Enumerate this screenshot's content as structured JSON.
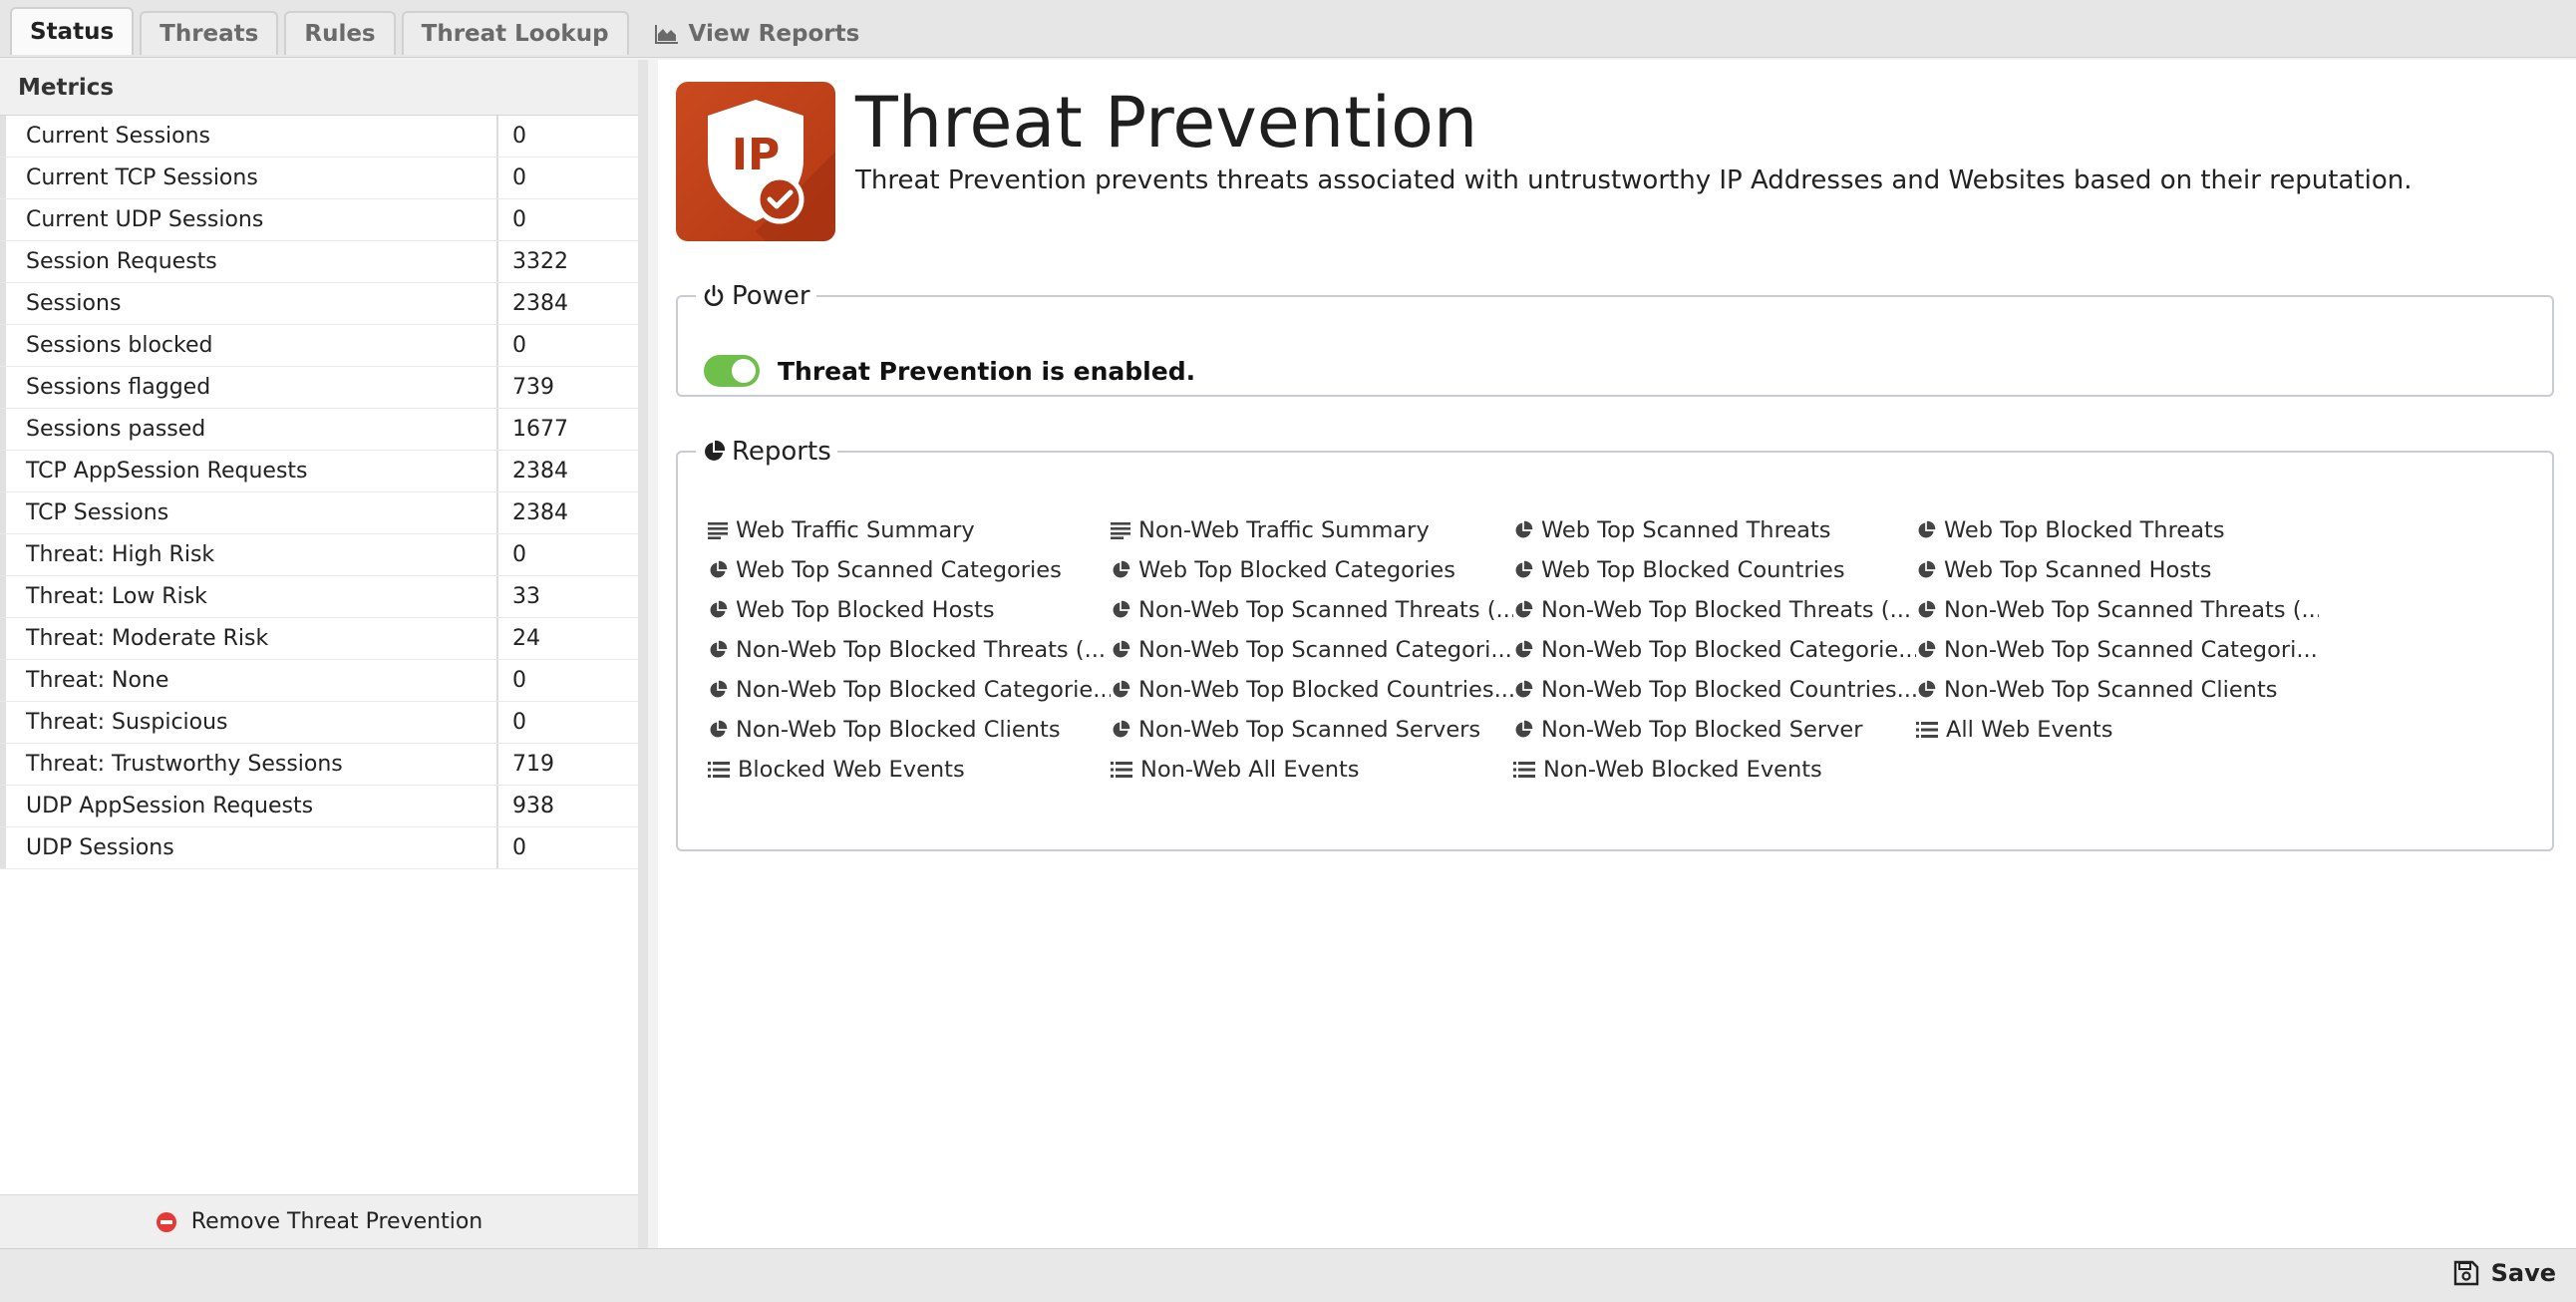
{
  "tabs": [
    {
      "label": "Status",
      "active": true
    },
    {
      "label": "Threats"
    },
    {
      "label": "Rules"
    },
    {
      "label": "Threat Lookup"
    },
    {
      "label": "View Reports",
      "icon": "area-chart-icon"
    }
  ],
  "metrics": {
    "header": "Metrics",
    "rows": [
      {
        "name": "Current Sessions",
        "value": "0"
      },
      {
        "name": "Current TCP Sessions",
        "value": "0"
      },
      {
        "name": "Current UDP Sessions",
        "value": "0"
      },
      {
        "name": "Session Requests",
        "value": "3322"
      },
      {
        "name": "Sessions",
        "value": "2384"
      },
      {
        "name": "Sessions blocked",
        "value": "0"
      },
      {
        "name": "Sessions flagged",
        "value": "739"
      },
      {
        "name": "Sessions passed",
        "value": "1677"
      },
      {
        "name": "TCP AppSession Requests",
        "value": "2384"
      },
      {
        "name": "TCP Sessions",
        "value": "2384"
      },
      {
        "name": "Threat: High Risk",
        "value": "0"
      },
      {
        "name": "Threat: Low Risk",
        "value": "33"
      },
      {
        "name": "Threat: Moderate Risk",
        "value": "24"
      },
      {
        "name": "Threat: None",
        "value": "0"
      },
      {
        "name": "Threat: Suspicious",
        "value": "0"
      },
      {
        "name": "Threat: Trustworthy Sessions",
        "value": "719"
      },
      {
        "name": "UDP AppSession Requests",
        "value": "938"
      },
      {
        "name": "UDP Sessions",
        "value": "0"
      }
    ],
    "remove_label": "Remove Threat Prevention"
  },
  "app": {
    "icon_text": "IP",
    "title": "Threat Prevention",
    "description": "Threat Prevention prevents threats associated with untrustworthy IP Addresses and Websites based on their reputation."
  },
  "power": {
    "legend": "Power",
    "status": "Threat Prevention is enabled.",
    "enabled": true,
    "toggle_color": "#6ec04b"
  },
  "reports": {
    "legend": "Reports",
    "items": [
      {
        "label": "Web Traffic Summary",
        "icon": "text-lines-icon"
      },
      {
        "label": "Non-Web Traffic Summary",
        "icon": "text-lines-icon"
      },
      {
        "label": "Web Top Scanned Threats",
        "icon": "pie-chart-icon"
      },
      {
        "label": "Web Top Blocked Threats",
        "icon": "pie-chart-icon"
      },
      {
        "label": "Web Top Scanned Categories",
        "icon": "pie-chart-icon"
      },
      {
        "label": "Web Top Blocked Categories",
        "icon": "pie-chart-icon"
      },
      {
        "label": "Web Top Blocked Countries",
        "icon": "pie-chart-icon"
      },
      {
        "label": "Web Top Scanned Hosts",
        "icon": "pie-chart-icon"
      },
      {
        "label": "Web Top Blocked Hosts",
        "icon": "pie-chart-icon"
      },
      {
        "label": "Non-Web Top Scanned Threats (...",
        "icon": "pie-chart-icon"
      },
      {
        "label": "Non-Web Top Blocked Threats (...",
        "icon": "pie-chart-icon"
      },
      {
        "label": "Non-Web Top Scanned Threats (...",
        "icon": "pie-chart-icon"
      },
      {
        "label": "Non-Web Top Blocked Threats (...",
        "icon": "pie-chart-icon"
      },
      {
        "label": "Non-Web Top Scanned Categori...",
        "icon": "pie-chart-icon"
      },
      {
        "label": "Non-Web Top Blocked Categorie...",
        "icon": "pie-chart-icon"
      },
      {
        "label": "Non-Web Top Scanned Categori...",
        "icon": "pie-chart-icon"
      },
      {
        "label": "Non-Web Top Blocked Categorie...",
        "icon": "pie-chart-icon"
      },
      {
        "label": "Non-Web Top Blocked Countries...",
        "icon": "pie-chart-icon"
      },
      {
        "label": "Non-Web Top Blocked Countries...",
        "icon": "pie-chart-icon"
      },
      {
        "label": "Non-Web Top Scanned Clients",
        "icon": "pie-chart-icon"
      },
      {
        "label": "Non-Web Top Blocked Clients",
        "icon": "pie-chart-icon"
      },
      {
        "label": "Non-Web Top Scanned Servers",
        "icon": "pie-chart-icon"
      },
      {
        "label": "Non-Web Top Blocked Server",
        "icon": "pie-chart-icon"
      },
      {
        "label": "All Web Events",
        "icon": "list-icon"
      },
      {
        "label": "Blocked Web Events",
        "icon": "list-icon"
      },
      {
        "label": "Non-Web All Events",
        "icon": "list-icon"
      },
      {
        "label": "Non-Web Blocked Events",
        "icon": "list-icon"
      }
    ]
  },
  "footer": {
    "save_label": "Save"
  },
  "colors": {
    "app_icon_bg": "#c2441b",
    "remove_icon": "#e53935",
    "toggle_on": "#6ec04b"
  }
}
